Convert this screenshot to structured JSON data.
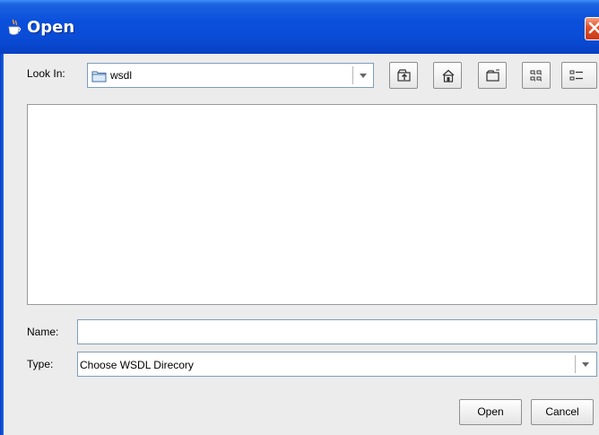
{
  "window": {
    "title": "Open",
    "close_icon": "close-icon",
    "app_icon": "java-cup-icon"
  },
  "look_in": {
    "label": "Look In:",
    "value": "wsdl",
    "value_icon": "folder-icon"
  },
  "toolbar": {
    "up_one_level": "up-folder-icon",
    "home": "home-icon",
    "new_folder": "new-folder-icon",
    "list_view": "list-view-icon",
    "details_view": "details-view-icon"
  },
  "file_list": {
    "items": []
  },
  "name": {
    "label": "Name:",
    "value": ""
  },
  "type": {
    "label": "Type:",
    "value": "Choose WSDL Direcory"
  },
  "buttons": {
    "open": "Open",
    "cancel": "Cancel"
  },
  "colors": {
    "titlebar": "#0a4cd6",
    "close": "#e0512a",
    "background": "#ececec"
  }
}
